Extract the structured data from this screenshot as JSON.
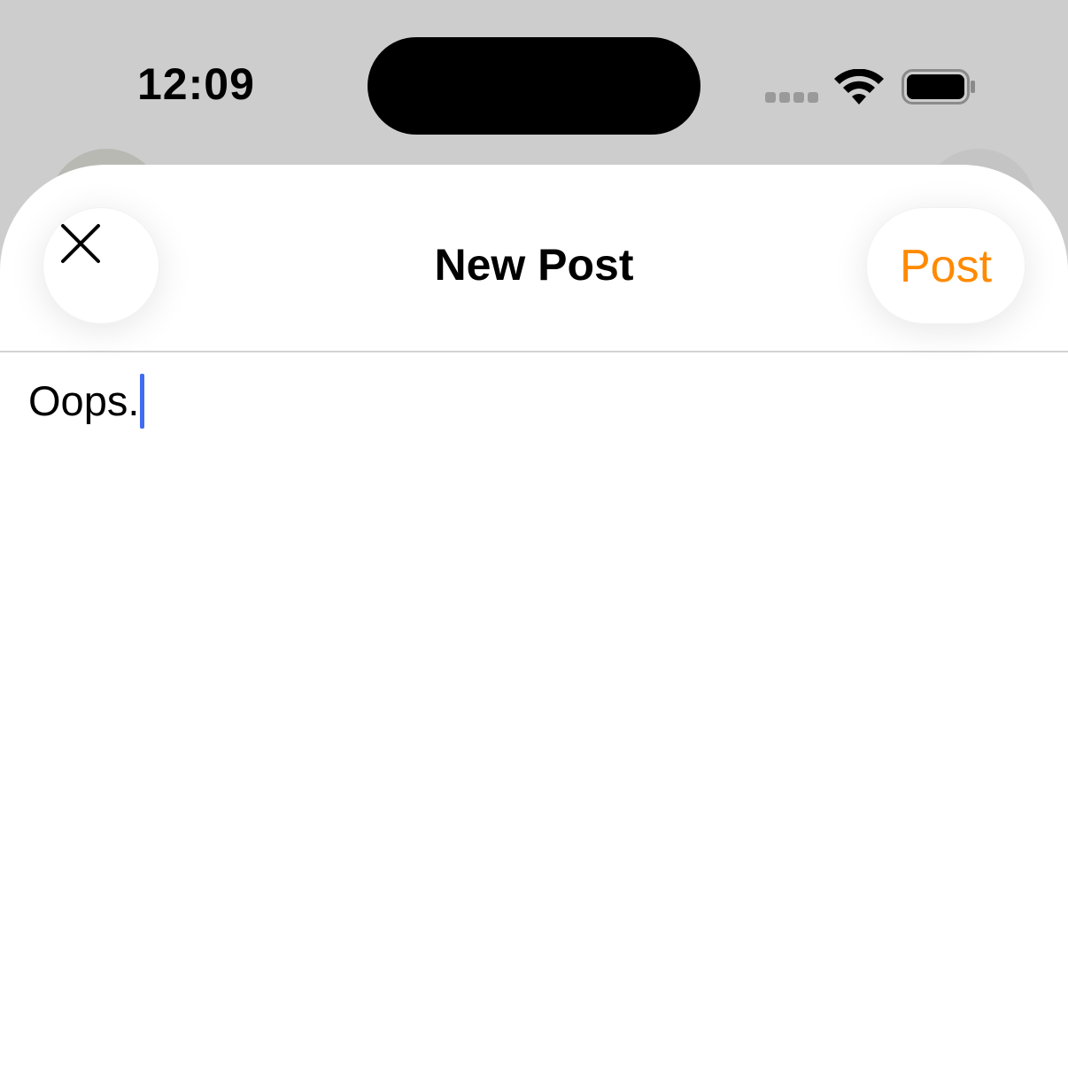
{
  "status_bar": {
    "time": "12:09",
    "icons": [
      "cellular-signal-icon",
      "wifi-icon",
      "battery-icon"
    ]
  },
  "header": {
    "title": "New Post",
    "close_icon": "close-icon",
    "post_label": "Post"
  },
  "editor": {
    "value": "Oops."
  },
  "colors": {
    "accent": "#ff8a00",
    "caret": "#3f6cf0",
    "backdrop": "#cdcdcd"
  }
}
